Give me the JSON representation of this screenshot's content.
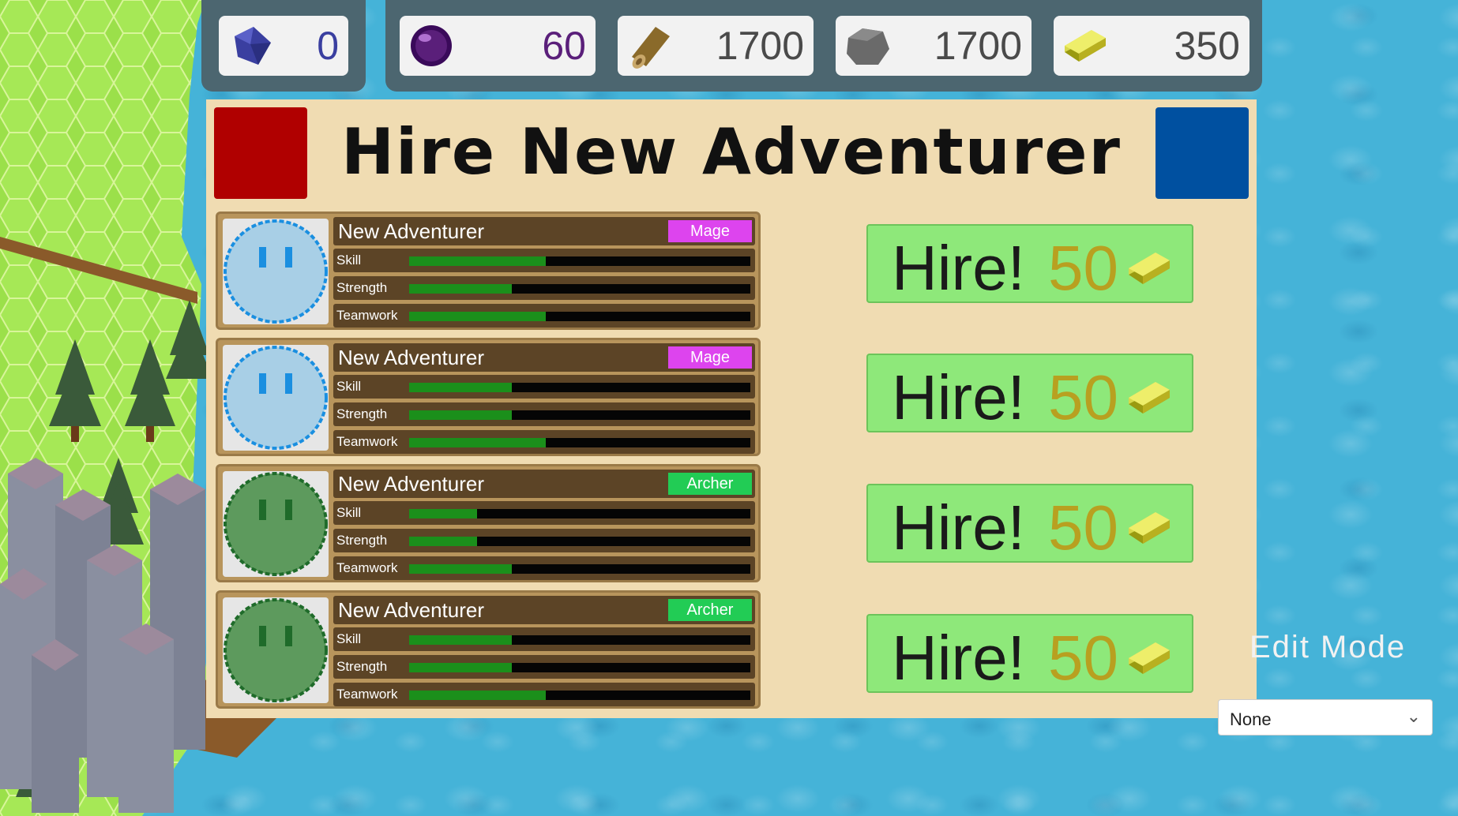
{
  "resources": [
    {
      "icon": "crystal-icon",
      "value": "0",
      "color": "#3a3fa0"
    },
    {
      "icon": "orb-icon",
      "value": "60",
      "color": "#5a1f7a"
    },
    {
      "icon": "wood-log-icon",
      "value": "1700",
      "color": "#4a4a4a"
    },
    {
      "icon": "stone-icon",
      "value": "1700",
      "color": "#4a4a4a"
    },
    {
      "icon": "gold-bar-icon",
      "value": "350",
      "color": "#4a4a4a"
    }
  ],
  "panel": {
    "title": "Hire New Adventurer"
  },
  "adventurers": [
    {
      "name": "New Adventurer",
      "class": "Mage",
      "class_color": "#dd44ee",
      "face_color": "#a8cfe6",
      "face_outline": "#1a8fe0",
      "stats": [
        {
          "label": "Skill",
          "value": 0.4
        },
        {
          "label": "Strength",
          "value": 0.3
        },
        {
          "label": "Teamwork",
          "value": 0.4
        }
      ],
      "hire_label": "Hire!",
      "hire_cost": "50"
    },
    {
      "name": "New Adventurer",
      "class": "Mage",
      "class_color": "#dd44ee",
      "face_color": "#a8cfe6",
      "face_outline": "#1a8fe0",
      "stats": [
        {
          "label": "Skill",
          "value": 0.3
        },
        {
          "label": "Strength",
          "value": 0.3
        },
        {
          "label": "Teamwork",
          "value": 0.4
        }
      ],
      "hire_label": "Hire!",
      "hire_cost": "50"
    },
    {
      "name": "New Adventurer",
      "class": "Archer",
      "class_color": "#22cc55",
      "face_color": "#5d9a5d",
      "face_outline": "#1f6b2a",
      "stats": [
        {
          "label": "Skill",
          "value": 0.2
        },
        {
          "label": "Strength",
          "value": 0.2
        },
        {
          "label": "Teamwork",
          "value": 0.3
        }
      ],
      "hire_label": "Hire!",
      "hire_cost": "50"
    },
    {
      "name": "New Adventurer",
      "class": "Archer",
      "class_color": "#22cc55",
      "face_color": "#5d9a5d",
      "face_outline": "#1f6b2a",
      "stats": [
        {
          "label": "Skill",
          "value": 0.3
        },
        {
          "label": "Strength",
          "value": 0.3
        },
        {
          "label": "Teamwork",
          "value": 0.4
        }
      ],
      "hire_label": "Hire!",
      "hire_cost": "50"
    }
  ],
  "edit_mode": {
    "label": "Edit Mode",
    "dropdown_value": "None"
  }
}
